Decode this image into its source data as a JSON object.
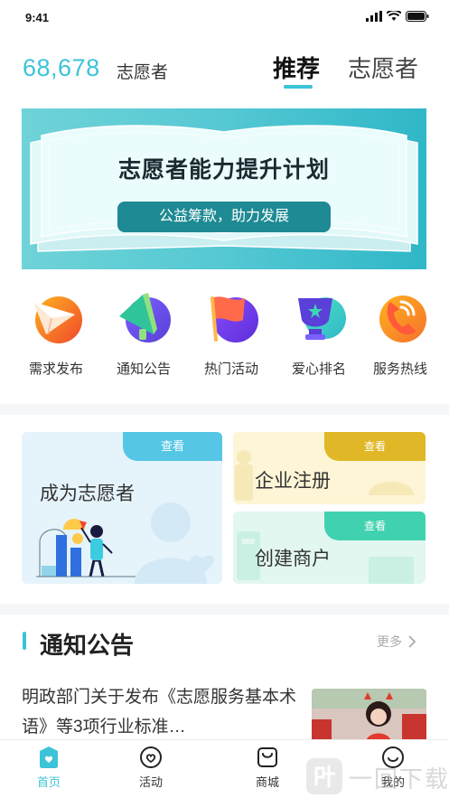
{
  "status_bar": {
    "time": "9:41"
  },
  "header": {
    "volunteer_count": "68,678",
    "volunteer_label": "志愿者",
    "tabs": [
      {
        "label": "推荐",
        "active": true
      },
      {
        "label": "志愿者",
        "active": false
      }
    ]
  },
  "banner": {
    "title": "志愿者能力提升计划",
    "pill": "公益筹款，助力发展"
  },
  "quick_actions": [
    {
      "label": "需求发布",
      "icon": "paper-plane-icon"
    },
    {
      "label": "通知公告",
      "icon": "megaphone-icon"
    },
    {
      "label": "热门活动",
      "icon": "flag-icon"
    },
    {
      "label": "爱心排名",
      "icon": "trophy-icon"
    },
    {
      "label": "服务热线",
      "icon": "phone-icon"
    }
  ],
  "cards": {
    "volunteer": {
      "title": "成为志愿者",
      "action": "查看"
    },
    "enterprise": {
      "title": "企业注册",
      "action": "查看"
    },
    "merchant": {
      "title": "创建商户",
      "action": "查看"
    }
  },
  "notices": {
    "section_title": "通知公告",
    "more_label": "更多",
    "items": [
      {
        "title": "明政部门关于发布《志愿服务基本术语》等3项行业标准…"
      }
    ]
  },
  "tabbar": [
    {
      "label": "首页",
      "icon": "home-icon",
      "active": true
    },
    {
      "label": "活动",
      "icon": "activity-icon",
      "active": false
    },
    {
      "label": "商城",
      "icon": "shop-bag-icon",
      "active": false
    },
    {
      "label": "我的",
      "icon": "profile-icon",
      "active": false
    }
  ],
  "watermark": {
    "text": "一回下载"
  },
  "colors": {
    "accent": "#3cc3d8",
    "banner_pill": "#1e8a93",
    "card_volunteer_tab": "#55c6e6",
    "card_enterprise_tab": "#e0b726",
    "card_merchant_tab": "#40d2b0"
  }
}
